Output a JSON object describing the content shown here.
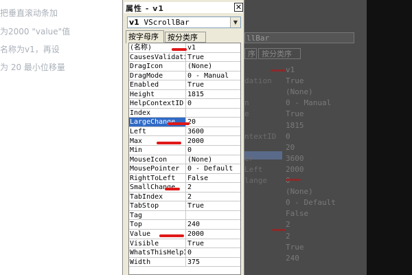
{
  "background_text": [
    "把垂直滚动条加",
    "为2000 \"value\"值",
    "名称为v1，再设",
    "为 20  最小位移量"
  ],
  "window": {
    "title": "属性 - v1",
    "close_glyph": "✕",
    "object_selector": {
      "name": "v1",
      "type": "VScrollBar"
    },
    "dropdown_glyph": "▼",
    "tabs": [
      {
        "label": "按字母序",
        "active": true
      },
      {
        "label": "按分类序",
        "active": false
      }
    ]
  },
  "properties": [
    {
      "name": "(名称)",
      "value": "v1"
    },
    {
      "name": "CausesValidation",
      "value": "True"
    },
    {
      "name": "DragIcon",
      "value": "(None)"
    },
    {
      "name": "DragMode",
      "value": "0 - Manual"
    },
    {
      "name": "Enabled",
      "value": "True"
    },
    {
      "name": "Height",
      "value": "1815"
    },
    {
      "name": "HelpContextID",
      "value": "0"
    },
    {
      "name": "Index",
      "value": ""
    },
    {
      "name": "LargeChange",
      "value": "20",
      "selected": true
    },
    {
      "name": "Left",
      "value": "3600"
    },
    {
      "name": "Max",
      "value": "2000"
    },
    {
      "name": "Min",
      "value": "0"
    },
    {
      "name": "MouseIcon",
      "value": "(None)"
    },
    {
      "name": "MousePointer",
      "value": "0 - Default"
    },
    {
      "name": "RightToLeft",
      "value": "False"
    },
    {
      "name": "SmallChange",
      "value": "2"
    },
    {
      "name": "TabIndex",
      "value": "2"
    },
    {
      "name": "TabStop",
      "value": "True"
    },
    {
      "name": "Tag",
      "value": ""
    },
    {
      "name": "Top",
      "value": "240"
    },
    {
      "name": "Value",
      "value": "2000"
    },
    {
      "name": "Visible",
      "value": "True"
    },
    {
      "name": "WhatsThisHelpID",
      "value": "0"
    },
    {
      "name": "Width",
      "value": "375"
    }
  ],
  "ghost": {
    "combo_text": "llBar",
    "tab_partial": "序",
    "tab2": "按分类序",
    "names": [
      "dation",
      "n",
      "e",
      "ntextID",
      "er",
      "Left",
      "lange"
    ],
    "values": [
      "v1",
      "True",
      "(None)",
      "0 - Manual",
      "True",
      "1815",
      "0",
      "20",
      "3600",
      "2000",
      "0",
      "(None)",
      "0 - Default",
      "False",
      "2",
      "2",
      "True",
      "240"
    ]
  },
  "colors": {
    "selection": "#316ac5",
    "annotation_red": "#e01818",
    "window_bg": "#ece9d8"
  }
}
